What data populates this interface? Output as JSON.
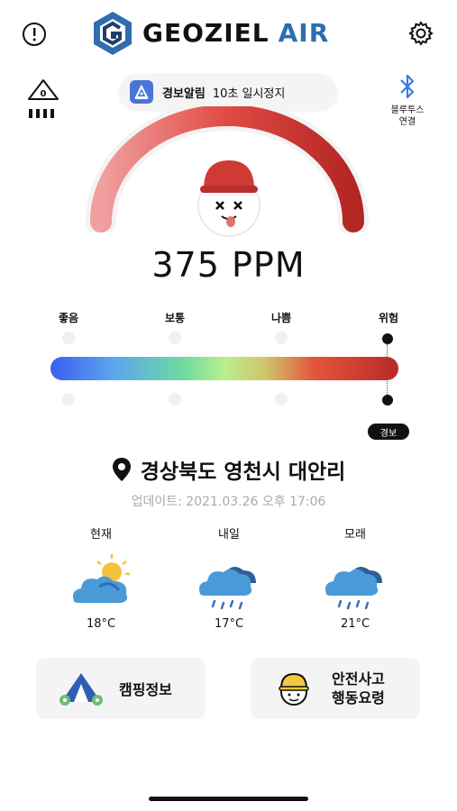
{
  "header": {
    "logo_part1": "GEOZIEL",
    "logo_part2": "AIR",
    "info_icon": "info-circle-icon",
    "settings_icon": "gear-icon"
  },
  "sensor": {
    "badge_value": "0",
    "icon": "warning-triangle-icon"
  },
  "alert_pill": {
    "title": "경보알림",
    "action": "10초 일시정지"
  },
  "bluetooth": {
    "label_line1": "블루투스",
    "label_line2": "연결",
    "icon": "bluetooth-icon"
  },
  "reading": {
    "value": "375 PPM",
    "gauge_fraction": 1.0
  },
  "scale": {
    "levels": [
      "좋음",
      "보통",
      "나쁨",
      "위험"
    ],
    "current_level_index": 3,
    "badge": "경보"
  },
  "location": {
    "name": "경상북도 영천시 대안리",
    "updated": "업데이트: 2021.03.26 오후 17:06"
  },
  "weather": [
    {
      "label": "현재",
      "temp": "18°C",
      "icon": "sun-cloud-icon"
    },
    {
      "label": "내일",
      "temp": "17°C",
      "icon": "rain-cloud-icon"
    },
    {
      "label": "모래",
      "temp": "21°C",
      "icon": "rain-cloud-icon"
    }
  ],
  "cards": {
    "camping": "캠핑정보",
    "safety_line1": "안전사고",
    "safety_line2": "행동요령"
  },
  "colors": {
    "accent_blue": "#2f6db0",
    "gauge_red": "#c7302c",
    "pill_icon_blue": "#4a74d6"
  }
}
